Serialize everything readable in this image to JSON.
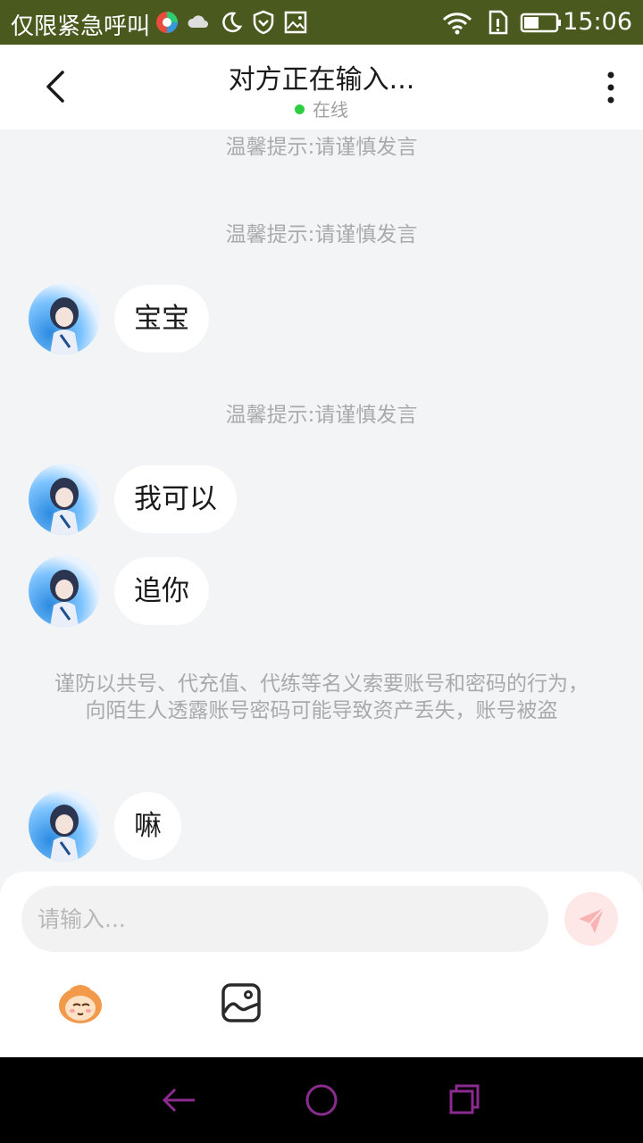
{
  "status_bar": {
    "carrier": "仅限紧急呼叫",
    "time": "15:06",
    "icons": [
      "app-icon",
      "cloud-icon",
      "moon-icon",
      "shield-icon",
      "gallery-icon",
      "wifi-icon",
      "sim-icon",
      "battery-icon"
    ]
  },
  "header": {
    "title": "对方正在输入...",
    "status": "在线",
    "back_icon": "chevron-left-icon",
    "more_icon": "more-vertical-icon"
  },
  "chat": {
    "notice_text": "温馨提示:请谨慎发言",
    "warning_text": "谨防以共号、代充值、代练等名义索要账号和密码的行为，向陌生人透露账号密码可能导致资产丢失，账号被盗",
    "messages": [
      "宝宝",
      "我可以",
      "追你",
      "嘛"
    ]
  },
  "composer": {
    "placeholder": "请输入...",
    "send_icon": "send-icon",
    "emoji_icon": "emoji-icon",
    "image_icon": "image-icon"
  },
  "nav_bar": {
    "icons": [
      "back-arrow-icon",
      "home-circle-icon",
      "recents-icon"
    ],
    "color": "#8b2a8f"
  }
}
